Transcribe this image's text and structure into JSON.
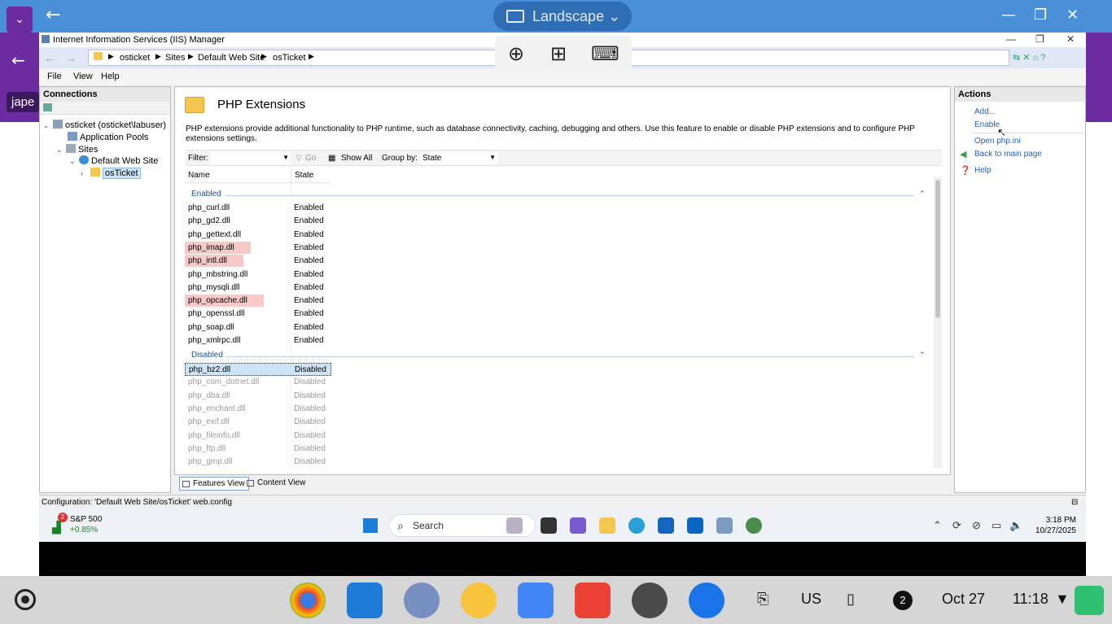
{
  "chromeos": {
    "mode_label": "Landscape",
    "purple_app_text": "jape"
  },
  "iis": {
    "window_title": "Internet Information Services (IIS) Manager",
    "breadcrumb": [
      "osticket",
      "Sites",
      "Default Web Site",
      "osTicket"
    ],
    "menu": [
      "File",
      "View",
      "Help"
    ],
    "connections": {
      "header": "Connections",
      "tree": [
        {
          "label": "osticket (osticket\\labuser)",
          "expand": "⌄"
        },
        {
          "label": "Application Pools",
          "expand": ""
        },
        {
          "label": "Sites",
          "expand": "⌄"
        },
        {
          "label": "Default Web Site",
          "expand": "⌄"
        },
        {
          "label": "osTicket",
          "expand": "›"
        }
      ]
    },
    "page": {
      "title": "PHP Extensions",
      "description": "PHP extensions provide additional functionality to PHP runtime, such as database connectivity, caching, debugging and others. Use this feature to enable or disable PHP extensions and to configure PHP extensions settings.",
      "filter_label": "Filter:",
      "go_label": "Go",
      "show_all_label": "Show All",
      "group_by_label": "Group by:",
      "group_by_value": "State",
      "col_name": "Name",
      "col_state": "State",
      "group_enabled": "Enabled",
      "group_disabled": "Disabled",
      "enabled_rows": [
        {
          "name": "php_curl.dll",
          "state": "Enabled"
        },
        {
          "name": "php_gd2.dll",
          "state": "Enabled"
        },
        {
          "name": "php_gettext.dll",
          "state": "Enabled"
        },
        {
          "name": "php_imap.dll",
          "state": "Enabled"
        },
        {
          "name": "php_intl.dll",
          "state": "Enabled"
        },
        {
          "name": "php_mbstring.dll",
          "state": "Enabled"
        },
        {
          "name": "php_mysqli.dll",
          "state": "Enabled"
        },
        {
          "name": "php_opcache.dll",
          "state": "Enabled"
        },
        {
          "name": "php_openssl.dll",
          "state": "Enabled"
        },
        {
          "name": "php_soap.dll",
          "state": "Enabled"
        },
        {
          "name": "php_xmlrpc.dll",
          "state": "Enabled"
        }
      ],
      "disabled_rows": [
        {
          "name": "php_bz2.dll",
          "state": "Disabled"
        },
        {
          "name": "php_com_dotnet.dll",
          "state": "Disabled"
        },
        {
          "name": "php_dba.dll",
          "state": "Disabled"
        },
        {
          "name": "php_enchant.dll",
          "state": "Disabled"
        },
        {
          "name": "php_exif.dll",
          "state": "Disabled"
        },
        {
          "name": "php_fileinfo.dll",
          "state": "Disabled"
        },
        {
          "name": "php_ftp.dll",
          "state": "Disabled"
        },
        {
          "name": "php_gmp.dll",
          "state": "Disabled"
        }
      ],
      "features_view": "Features View",
      "content_view": "Content View"
    },
    "actions": {
      "header": "Actions",
      "add": "Add...",
      "enable": "Enable",
      "open_ini": "Open php.ini",
      "back": "Back to main page",
      "help": "Help"
    },
    "status": "Configuration: 'Default Web Site/osTicket' web.config"
  },
  "taskbar": {
    "stock_name": "S&P 500",
    "stock_change": "+0.85%",
    "stock_badge": "2",
    "search_placeholder": "Search",
    "time": "3:18 PM",
    "date": "10/27/2025"
  },
  "shelf": {
    "locale": "US",
    "notif_count": "2",
    "date": "Oct 27",
    "time": "11:18"
  },
  "colors": {
    "cros_blue": "#4a90d9",
    "purple": "#6b2ca1",
    "highlight_row": "#f8c9c9",
    "link_blue": "#1f5fbf"
  }
}
